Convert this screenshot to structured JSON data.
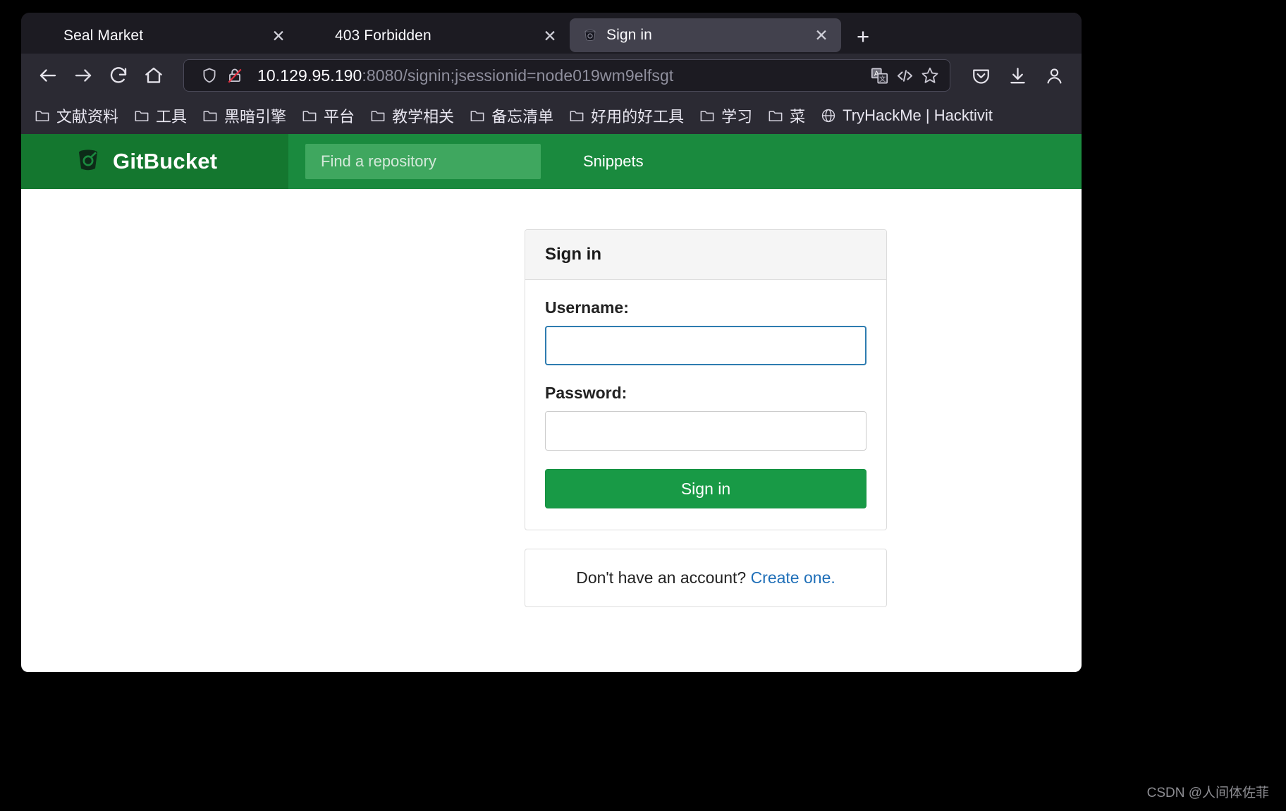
{
  "browser": {
    "tabs": [
      {
        "title": "Seal Market",
        "favicon": "none",
        "active": false,
        "close_label": "✕"
      },
      {
        "title": "403 Forbidden",
        "favicon": "none",
        "active": false,
        "close_label": "✕"
      },
      {
        "title": "Sign in",
        "favicon": "gitbucket-favicon",
        "active": true,
        "close_label": "✕"
      }
    ],
    "new_tab_label": "+",
    "nav": {
      "back_icon": "arrow-left-icon",
      "forward_icon": "arrow-right-icon",
      "reload_icon": "reload-icon",
      "home_icon": "home-icon"
    },
    "urlbar": {
      "shield_icon": "shield-icon",
      "security_icon": "lock-crossed-out-icon",
      "host": "10.129.95.190",
      "path": ":8080/signin;jsessionid=node019wm9elfsgt",
      "translate_icon": "translate-icon",
      "reader_icon": "code-view-icon",
      "bookmark_icon": "star-icon"
    },
    "toolbar_end": {
      "pocket_icon": "pocket-save-icon",
      "downloads_icon": "download-icon",
      "account_icon": "account-icon"
    },
    "bookmarks": [
      {
        "label": "文献资料",
        "icon": "folder-icon"
      },
      {
        "label": "工具",
        "icon": "folder-icon"
      },
      {
        "label": "黑暗引擎",
        "icon": "folder-icon"
      },
      {
        "label": "平台",
        "icon": "folder-icon"
      },
      {
        "label": "教学相关",
        "icon": "folder-icon"
      },
      {
        "label": "备忘清单",
        "icon": "folder-icon"
      },
      {
        "label": "好用的好工具",
        "icon": "folder-icon"
      },
      {
        "label": "学习",
        "icon": "folder-icon"
      },
      {
        "label": "菜",
        "icon": "folder-icon"
      },
      {
        "label": "TryHackMe | Hacktivit",
        "icon": "globe-icon"
      }
    ]
  },
  "site": {
    "header": {
      "brand_name": "GitBucket",
      "logo_icon": "gitbucket-logo-icon",
      "search_placeholder": "Find a repository",
      "search_value": "",
      "snippets_label": "Snippets"
    },
    "signin": {
      "panel_title": "Sign in",
      "username_label": "Username:",
      "username_value": "",
      "password_label": "Password:",
      "password_value": "",
      "submit_label": "Sign in"
    },
    "create_account": {
      "prompt": "Don't have an account?",
      "link_label": "Create one."
    }
  },
  "colors": {
    "gitbucket_green": "#1a8a3e",
    "gitbucket_brand_green": "#14772f",
    "button_green": "#189a46",
    "focus_blue": "#2e7cb0",
    "link_blue": "#1f6fb8"
  },
  "watermark": "CSDN @人间体佐菲"
}
